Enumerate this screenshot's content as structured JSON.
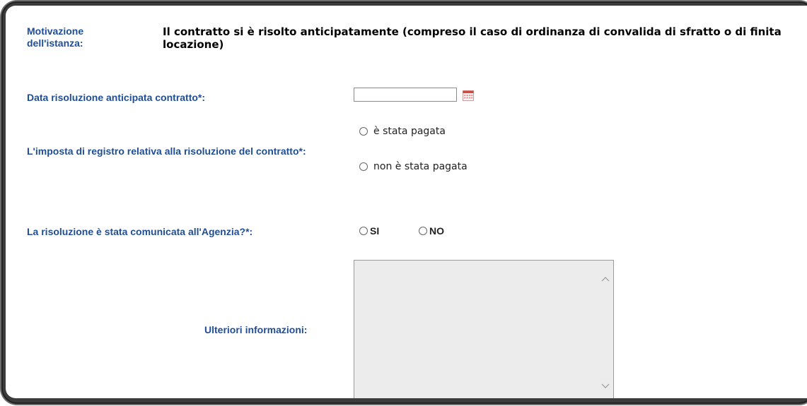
{
  "motivazione": {
    "label": "Motivazione\ndell'istanza:",
    "value": "Il contratto si è risolto anticipatamente (compreso il caso di ordinanza di convalida di sfratto o di finita\nlocazione)"
  },
  "data_risoluzione": {
    "label": "Data risoluzione anticipata contratto*:",
    "value": "",
    "icon": "calendar-icon"
  },
  "imposta_registro": {
    "label": "L'imposta di registro relativa alla risoluzione del contratto*:",
    "options": [
      "è stata pagata",
      "non è stata pagata"
    ]
  },
  "comunicata_agenzia": {
    "label": "La risoluzione è stata comunicata all'Agenzia?*:",
    "options": [
      "SI",
      "NO"
    ]
  },
  "ulteriori_informazioni": {
    "label": "Ulteriori informazioni:",
    "value": ""
  },
  "colors": {
    "label_blue": "#1f4e96",
    "textarea_bg": "#ececec",
    "frame_dark": "#3c3c3c"
  }
}
